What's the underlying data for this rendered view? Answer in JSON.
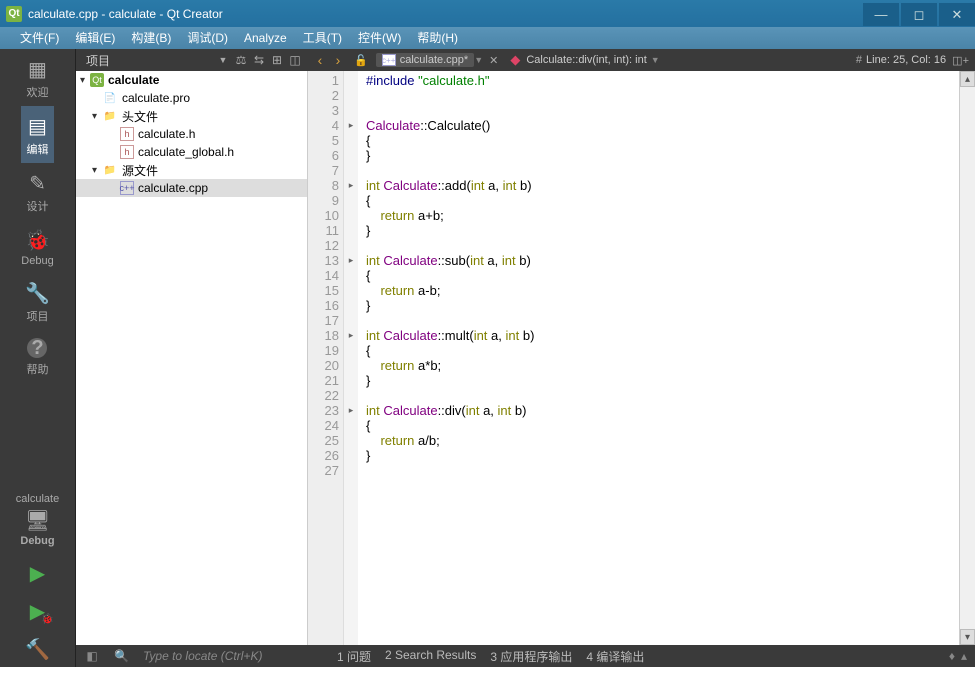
{
  "window": {
    "title": "calculate.cpp - calculate - Qt Creator"
  },
  "menu": [
    "文件(F)",
    "编辑(E)",
    "构建(B)",
    "调试(D)",
    "Analyze",
    "工具(T)",
    "控件(W)",
    "帮助(H)"
  ],
  "rail": {
    "items": [
      {
        "id": "welcome",
        "label": "欢迎",
        "icon": "grid"
      },
      {
        "id": "editor",
        "label": "编辑",
        "icon": "doc",
        "active": true
      },
      {
        "id": "design",
        "label": "设计",
        "icon": "pencil"
      },
      {
        "id": "debug",
        "label": "Debug",
        "icon": "bug"
      },
      {
        "id": "project",
        "label": "项目",
        "icon": "wrench"
      },
      {
        "id": "help",
        "label": "帮助",
        "icon": "help"
      }
    ],
    "target": {
      "name": "calculate",
      "config": "Debug"
    },
    "run_icons": [
      "play",
      "play-debug",
      "hammer"
    ]
  },
  "proj_panel": {
    "title": "项目"
  },
  "tree": {
    "root": "calculate",
    "pro": "calculate.pro",
    "headers_label": "头文件",
    "headers": [
      "calculate.h",
      "calculate_global.h"
    ],
    "sources_label": "源文件",
    "sources": [
      "calculate.cpp"
    ]
  },
  "editor_bar": {
    "file": "calculate.cpp*",
    "symbol": "Calculate::div(int, int): int",
    "cursor": "Line: 25, Col: 16"
  },
  "code_lines": [
    {
      "n": 1,
      "html": "<span class=\"pre\">#include</span> <span class=\"str\">\"calculate.h\"</span>"
    },
    {
      "n": 2,
      "html": ""
    },
    {
      "n": 3,
      "html": ""
    },
    {
      "n": 4,
      "fold": true,
      "html": "<span class=\"ty\">Calculate</span>::Calculate()"
    },
    {
      "n": 5,
      "html": "{"
    },
    {
      "n": 6,
      "html": "}"
    },
    {
      "n": 7,
      "html": ""
    },
    {
      "n": 8,
      "fold": true,
      "html": "<span class=\"kw\">int</span> <span class=\"ty\">Calculate</span>::add(<span class=\"kw\">int</span> a, <span class=\"kw\">int</span> b)"
    },
    {
      "n": 9,
      "html": "{"
    },
    {
      "n": 10,
      "html": "    <span class=\"kw\">return</span> a+b;"
    },
    {
      "n": 11,
      "html": "}"
    },
    {
      "n": 12,
      "html": ""
    },
    {
      "n": 13,
      "fold": true,
      "html": "<span class=\"kw\">int</span> <span class=\"ty\">Calculate</span>::sub(<span class=\"kw\">int</span> a, <span class=\"kw\">int</span> b)"
    },
    {
      "n": 14,
      "html": "{"
    },
    {
      "n": 15,
      "html": "    <span class=\"kw\">return</span> a-b;"
    },
    {
      "n": 16,
      "html": "}"
    },
    {
      "n": 17,
      "html": ""
    },
    {
      "n": 18,
      "fold": true,
      "html": "<span class=\"kw\">int</span> <span class=\"ty\">Calculate</span>::mult(<span class=\"kw\">int</span> a, <span class=\"kw\">int</span> b)"
    },
    {
      "n": 19,
      "html": "{"
    },
    {
      "n": 20,
      "html": "    <span class=\"kw\">return</span> a*b;"
    },
    {
      "n": 21,
      "html": "}"
    },
    {
      "n": 22,
      "html": ""
    },
    {
      "n": 23,
      "fold": true,
      "html": "<span class=\"kw\">int</span> <span class=\"ty\">Calculate</span>::div(<span class=\"kw\">int</span> a, <span class=\"kw\">int</span> b)"
    },
    {
      "n": 24,
      "html": "{"
    },
    {
      "n": 25,
      "html": "    <span class=\"kw\">return</span> a/b;"
    },
    {
      "n": 26,
      "html": "}"
    },
    {
      "n": 27,
      "html": ""
    }
  ],
  "locator": {
    "placeholder": "Type to locate (Ctrl+K)"
  },
  "output_tabs": [
    "1 问题",
    "2 Search Results",
    "3 应用程序输出",
    "4 编译输出"
  ]
}
